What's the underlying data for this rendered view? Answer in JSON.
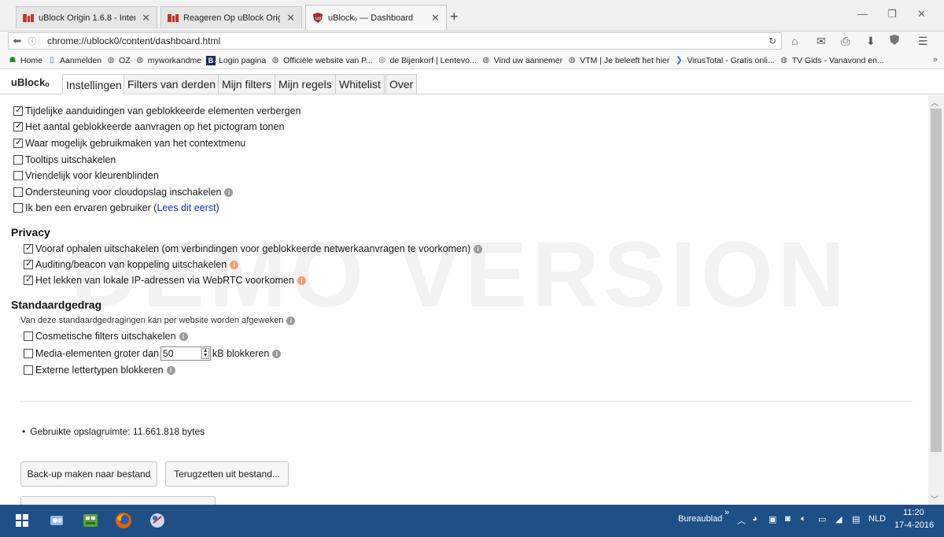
{
  "browser": {
    "tabs": [
      {
        "title": "uBlock Origin 1.6.8 - Inter...",
        "active": false
      },
      {
        "title": "Reageren Op uBlock Origi...",
        "active": false
      },
      {
        "title": "uBlockₒ — Dashboard",
        "active": true
      }
    ],
    "new_tab_glyph": "+",
    "url": "chrome://ublock0/content/dashboard.html",
    "bookmarks": [
      {
        "label": "Home",
        "icon": "home-bookmark-icon"
      },
      {
        "label": "Aanmelden",
        "icon": "page-icon"
      },
      {
        "label": "OZ",
        "icon": "globe-icon"
      },
      {
        "label": "myworkandme",
        "icon": "globe-icon"
      },
      {
        "label": "Login pagina",
        "icon": "b-icon"
      },
      {
        "label": "Officiële website van P...",
        "icon": "globe-icon"
      },
      {
        "label": "de Bijenkorf | Lentevo...",
        "icon": "spiral-icon"
      },
      {
        "label": "Vind uw aannemer",
        "icon": "globe-icon"
      },
      {
        "label": "VTM | Je beleeft het hier",
        "icon": "globe-icon"
      },
      {
        "label": "VirusTotal - Gratis onli...",
        "icon": "virustotal-icon"
      },
      {
        "label": "TV Gids - Vanavond en...",
        "icon": "globe-icon"
      }
    ],
    "bookmarks_more": "»"
  },
  "dashboard": {
    "brand": "uBlockₒ",
    "tabs": [
      "Instellingen",
      "Filters van derden",
      "Mijn filters",
      "Mijn regels",
      "Whitelist",
      "Over"
    ],
    "active_tab": "Instellingen"
  },
  "settings": {
    "general": [
      {
        "label": "Tijdelijke aanduidingen van geblokkeerde elementen verbergen",
        "checked": true
      },
      {
        "label": "Het aantal geblokkeerde aanvragen op het pictogram tonen",
        "checked": true
      },
      {
        "label": "Waar mogelijk gebruikmaken van het contextmenu",
        "checked": true
      },
      {
        "label": "Tooltips uitschakelen",
        "checked": false
      },
      {
        "label": "Vriendelijk voor kleurenblinden",
        "checked": false
      },
      {
        "label": "Ondersteuning voor cloudopslag inschakelen",
        "checked": false
      },
      {
        "label": "Ik ben een ervaren gebruiker (",
        "checked": false,
        "link": "Lees dit eerst",
        "suffix": ")"
      }
    ],
    "privacy_heading": "Privacy",
    "privacy": [
      {
        "label": "Vooraf ophalen uitschakelen (om verbindingen voor geblokkeerde netwerkaanvragen te voorkomen)",
        "checked": true
      },
      {
        "label": "Auditing/beacon van koppeling uitschakelen",
        "checked": true
      },
      {
        "label": "Het lekken van lokale IP-adressen via WebRTC voorkomen",
        "checked": true
      }
    ],
    "default_heading": "Standaardgedrag",
    "default_sub": "Van deze standaardgedragingen kan per website worden afgeweken",
    "default": [
      {
        "label": "Cosmetische filters uitschakelen",
        "checked": false
      },
      {
        "label": "Media-elementen groter dan",
        "checked": false,
        "value": "50",
        "suffix": "kB blokkeren"
      },
      {
        "label": "Externe lettertypen blokkeren",
        "checked": false
      }
    ],
    "storage_used": "Gebruikte opslagruimte: 11.661.818 bytes",
    "backup_button": "Back-up maken naar bestand",
    "restore_button": "Terugzetten uit bestand..."
  },
  "watermark": "DEMO VERSION",
  "taskbar": {
    "desktop_label": "Bureaublad",
    "language": "NLD",
    "time": "11:20",
    "date": "17-4-2016"
  },
  "colors": {
    "taskbar": "#1f4f87",
    "link": "#1030c0",
    "info_orange": "#f0a070"
  }
}
